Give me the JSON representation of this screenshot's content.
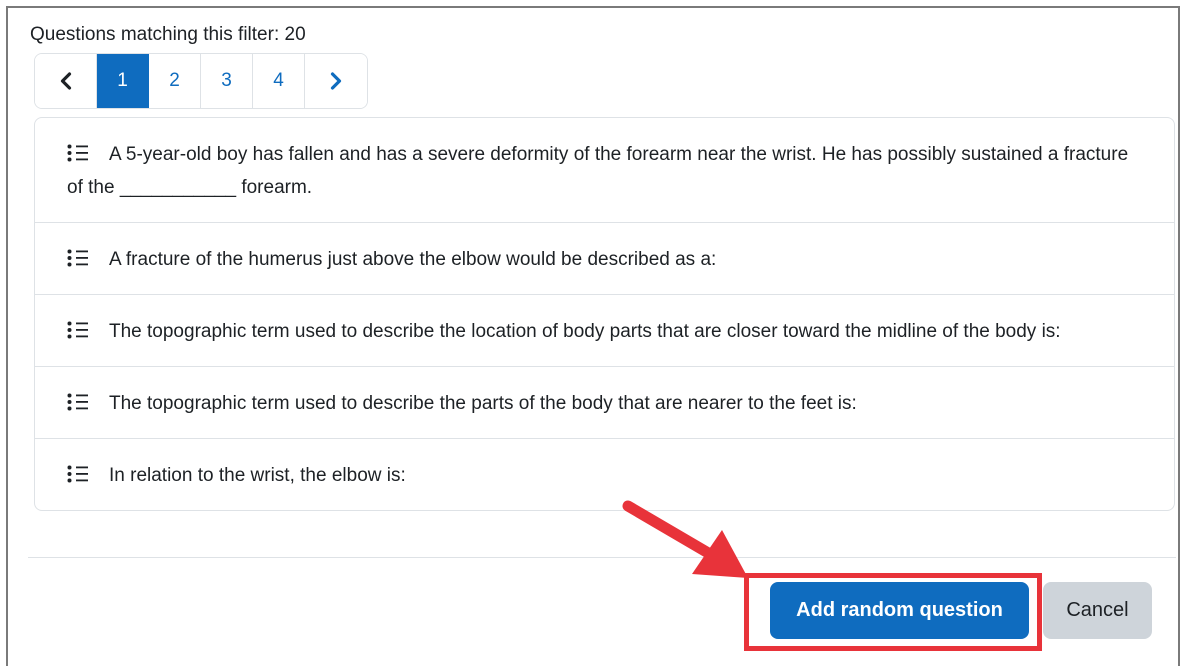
{
  "filter": {
    "label": "Questions matching this filter: 20"
  },
  "pagination": {
    "pages": [
      "1",
      "2",
      "3",
      "4"
    ],
    "active_page": "1"
  },
  "questions": [
    "A 5-year-old boy has fallen and has a severe deformity of the forearm near the wrist. He has possibly sustained a fracture of the ___________ forearm.",
    "A fracture of the humerus just above the elbow would be described as a:",
    "The topographic term used to describe the location of body parts that are closer toward the midline of the body is:",
    "The topographic term used to describe the parts of the body that are nearer to the feet is:",
    "In relation to the wrist, the elbow is:"
  ],
  "actions": {
    "add_label": "Add random question",
    "cancel_label": "Cancel"
  },
  "colors": {
    "primary": "#0f6cbf",
    "annotation_red": "#e8333a",
    "secondary_button": "#ced4da"
  },
  "icons": {
    "prev": "chevron-left-icon",
    "next": "chevron-right-icon",
    "question": "list-icon"
  }
}
